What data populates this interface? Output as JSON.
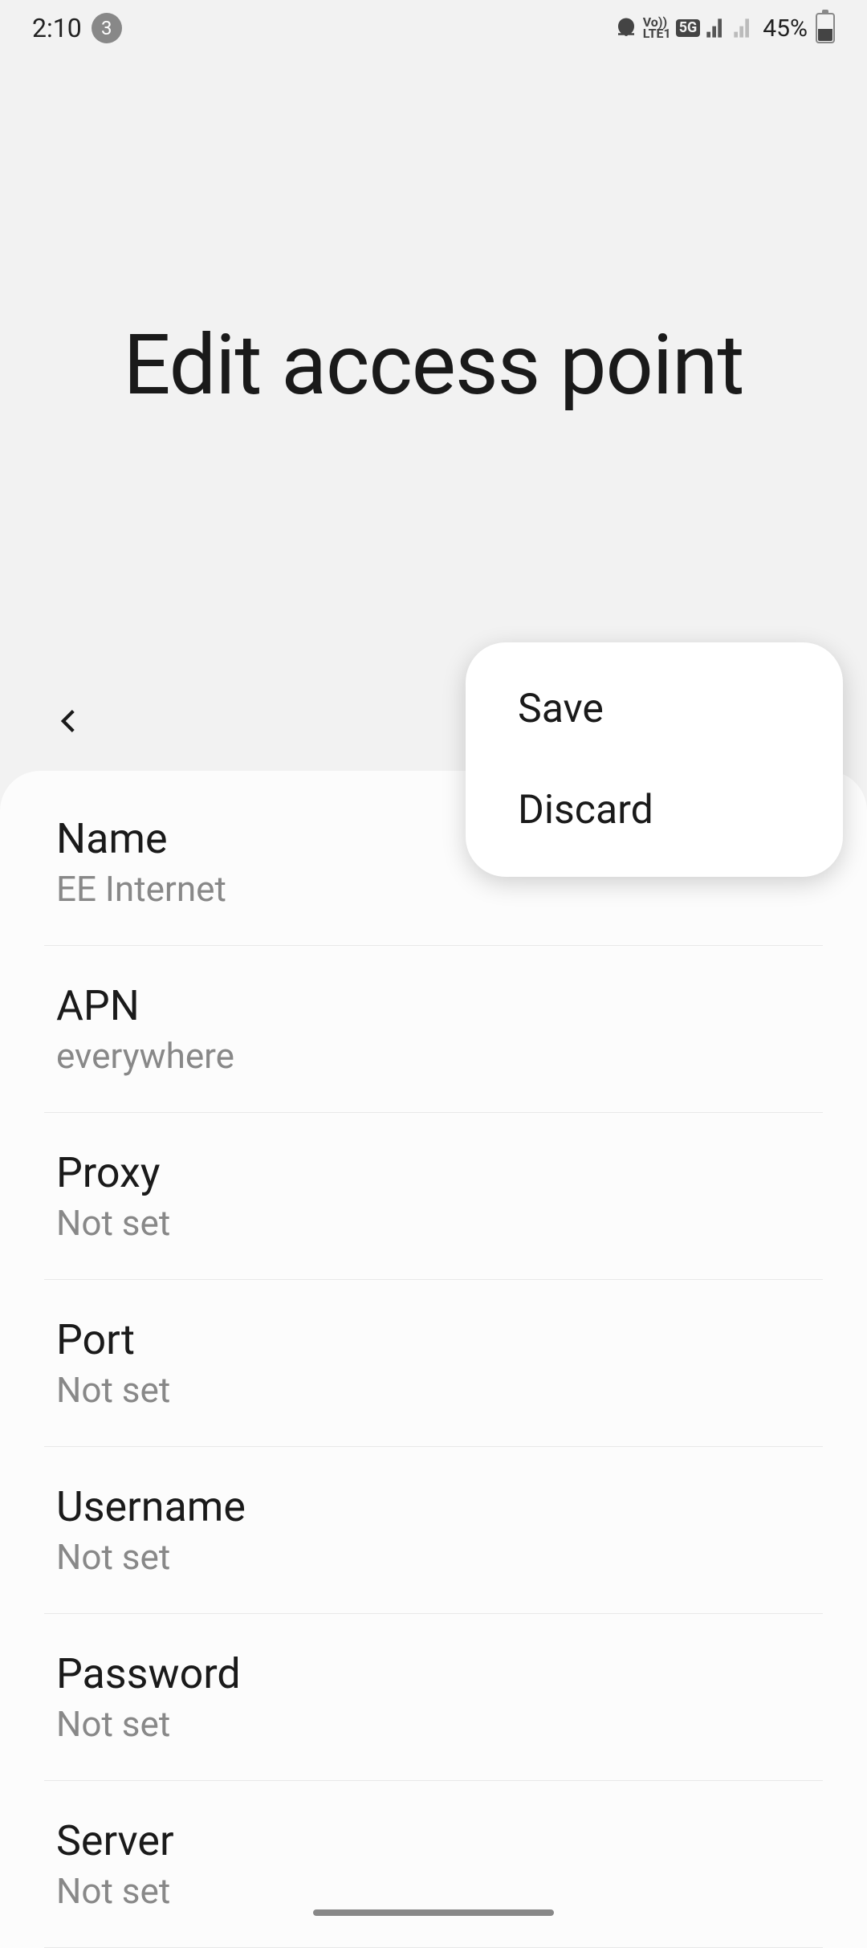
{
  "status": {
    "time": "2:10",
    "notif_count": "3",
    "battery": "45%"
  },
  "header": {
    "title": "Edit access point"
  },
  "menu": {
    "save": "Save",
    "discard": "Discard"
  },
  "settings": [
    {
      "label": "Name",
      "value": "EE Internet"
    },
    {
      "label": "APN",
      "value": "everywhere"
    },
    {
      "label": "Proxy",
      "value": "Not set"
    },
    {
      "label": "Port",
      "value": "Not set"
    },
    {
      "label": "Username",
      "value": "Not set"
    },
    {
      "label": "Password",
      "value": "Not set"
    },
    {
      "label": "Server",
      "value": "Not set"
    }
  ]
}
